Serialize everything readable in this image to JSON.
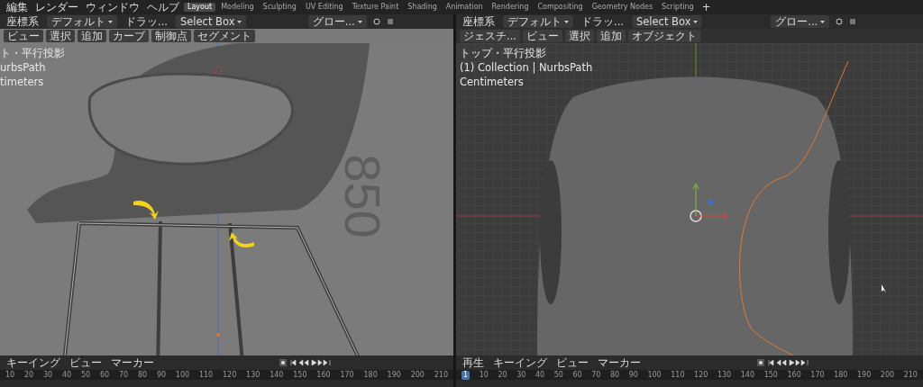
{
  "left_area": {
    "menu": [
      "編集",
      "レンダー",
      "ウィンドウ",
      "ヘルプ"
    ],
    "workspace_tabs": [
      {
        "label": "Layout",
        "selected": true
      },
      {
        "label": "Modeling",
        "selected": false
      },
      {
        "label": "Sculpting",
        "selected": false
      },
      {
        "label": "UV Editing",
        "selected": false
      },
      {
        "label": "Texture Paint",
        "selected": false
      },
      {
        "label": "Shading",
        "selected": false
      },
      {
        "label": "Animation",
        "selected": false
      },
      {
        "label": "Rendering",
        "selected": false
      },
      {
        "label": "Compositing",
        "selected": false
      },
      {
        "label": "Geometry Nodes",
        "selected": false
      },
      {
        "label": "Scripting",
        "selected": false
      }
    ],
    "add_tab": "+",
    "header": {
      "orientation": "座標系",
      "pivot": "デフォルト",
      "drag": "ドラッ...",
      "select_mode": "Select Box",
      "transform": "グロー..."
    },
    "view_menu": [
      "ビュー",
      "選択",
      "追加",
      "カーブ",
      "制御点",
      "セグメント"
    ],
    "overlay_text": [
      "ト・平行投影",
      "urbsPath",
      "timeters"
    ],
    "scene_label": "850"
  },
  "right_area": {
    "header": {
      "orientation": "座標系",
      "pivot": "デフォルト",
      "drag": "ドラッ...",
      "select_mode": "Select Box",
      "transform": "グロー..."
    },
    "view_menu": [
      "ジェスチ...",
      "ビュー",
      "選択",
      "追加",
      "オブジェクト"
    ],
    "overlay_text": [
      "トップ・平行投影",
      "(1) Collection | NurbsPath",
      "Centimeters"
    ]
  },
  "left_timeline": {
    "menu": [
      "キーイング",
      "ビュー",
      "マーカー"
    ],
    "ticks": [
      "10",
      "20",
      "30",
      "40",
      "50",
      "60",
      "70",
      "80",
      "90",
      "100",
      "110",
      "120",
      "130",
      "140",
      "150",
      "160",
      "170",
      "180",
      "190",
      "200",
      "210"
    ]
  },
  "right_timeline": {
    "menu": [
      "再生",
      "キーイング",
      "ビュー",
      "マーカー"
    ],
    "current_frame": "1",
    "ticks": [
      "10",
      "20",
      "30",
      "40",
      "50",
      "60",
      "70",
      "80",
      "90",
      "100",
      "110",
      "120",
      "130",
      "140",
      "150",
      "160",
      "170",
      "180",
      "190",
      "200",
      "210"
    ]
  }
}
